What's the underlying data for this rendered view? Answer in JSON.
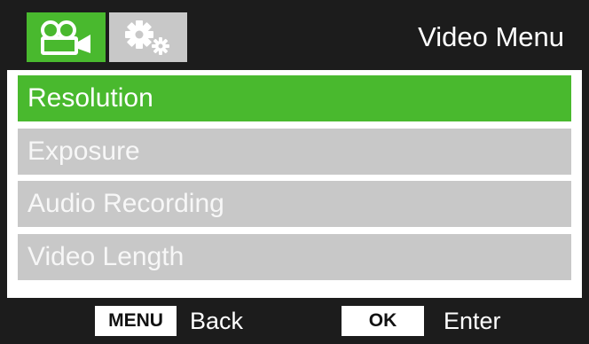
{
  "header": {
    "title": "Video Menu",
    "tabs": [
      {
        "icon": "video-camera-icon",
        "active": true
      },
      {
        "icon": "gears-icon",
        "active": false
      }
    ]
  },
  "menu": {
    "items": [
      {
        "label": "Resolution",
        "selected": true
      },
      {
        "label": "Exposure",
        "selected": false
      },
      {
        "label": "Audio Recording",
        "selected": false
      },
      {
        "label": "Video Length",
        "selected": false
      }
    ]
  },
  "footer": {
    "menu_key": "MENU",
    "menu_action": "Back",
    "ok_key": "OK",
    "ok_action": "Enter"
  },
  "colors": {
    "accent": "#49b92e",
    "inactive": "#c8c8c8",
    "frame": "#1c1c1c"
  }
}
